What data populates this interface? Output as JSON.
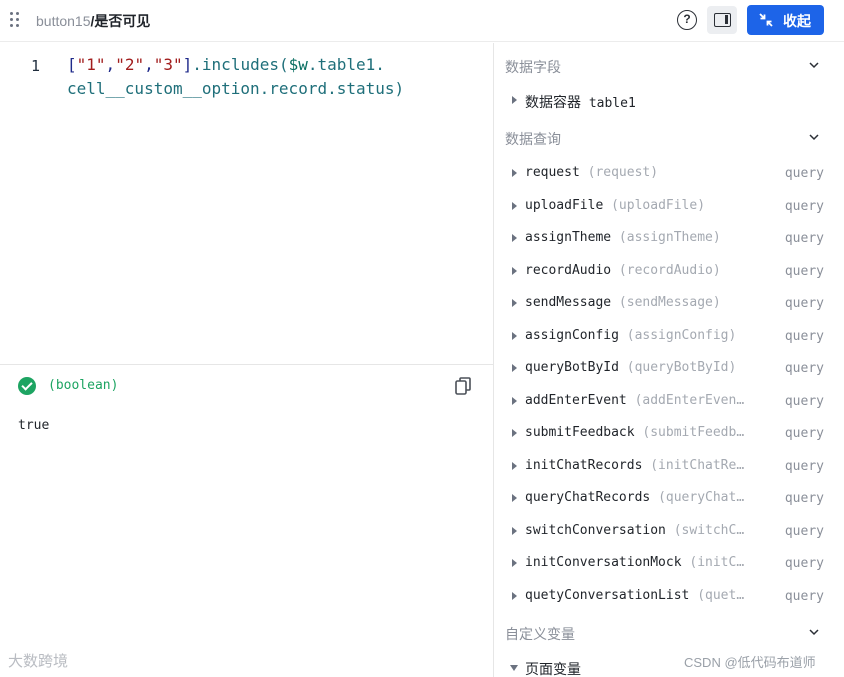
{
  "header": {
    "breadcrumb_parent": "button15",
    "breadcrumb_sep": "/",
    "breadcrumb_current": "是否可见",
    "help_glyph": "?",
    "collapse_label": "收起",
    "accent": "#1d64e8"
  },
  "editor": {
    "line_number": "1",
    "code": {
      "open": "[",
      "s1": "\"1\"",
      "c1": ",",
      "s2": "\"2\"",
      "c2": ",",
      "s3": "\"3\"",
      "close": "]",
      "call": ".includes(",
      "var": "$w",
      "rest1": ".table1.",
      "line2": "cell__custom__option.record.status)"
    }
  },
  "result": {
    "type": "(boolean)",
    "value": "true",
    "status_color": "#1da462"
  },
  "sidebar": {
    "sections": [
      {
        "title": "数据字段"
      },
      {
        "title": "数据查询"
      },
      {
        "title": "自定义变量"
      }
    ],
    "data_fields": {
      "label": "数据容器",
      "value": "table1"
    },
    "queries": [
      {
        "name": "request",
        "alias": "(request)",
        "tag": "query"
      },
      {
        "name": "uploadFile",
        "alias": "(uploadFile)",
        "tag": "query"
      },
      {
        "name": "assignTheme",
        "alias": "(assignTheme)",
        "tag": "query"
      },
      {
        "name": "recordAudio",
        "alias": "(recordAudio)",
        "tag": "query"
      },
      {
        "name": "sendMessage",
        "alias": "(sendMessage)",
        "tag": "query"
      },
      {
        "name": "assignConfig",
        "alias": "(assignConfig)",
        "tag": "query"
      },
      {
        "name": "queryBotById",
        "alias": "(queryBotById)",
        "tag": "query"
      },
      {
        "name": "addEnterEvent",
        "alias": "(addEnterEven…",
        "tag": "query"
      },
      {
        "name": "submitFeedback",
        "alias": "(submitFeedb…",
        "tag": "query"
      },
      {
        "name": "initChatRecords",
        "alias": "(initChatRe…",
        "tag": "query"
      },
      {
        "name": "queryChatRecords",
        "alias": "(queryChat…",
        "tag": "query"
      },
      {
        "name": "switchConversation",
        "alias": "(switchC…",
        "tag": "query"
      },
      {
        "name": "initConversationMock",
        "alias": "(initC…",
        "tag": "query"
      },
      {
        "name": "quetyConversationList",
        "alias": "(quet…",
        "tag": "query"
      }
    ],
    "page_vars": {
      "label": "页面变量"
    }
  },
  "watermarks": {
    "left": "大数跨境",
    "right": "CSDN @低代码布道师"
  }
}
